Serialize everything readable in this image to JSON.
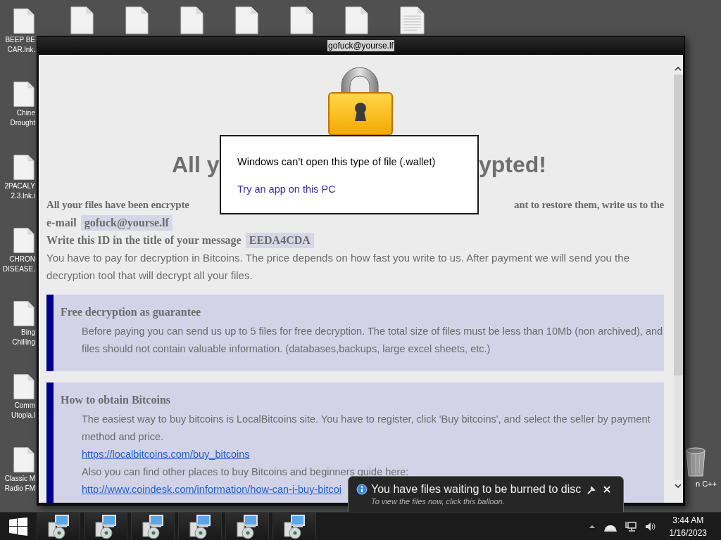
{
  "desktop": {
    "left_icons": [
      {
        "kind": "file",
        "label_lines": [
          "BEEP BE",
          "CAR.lnk."
        ]
      },
      {
        "kind": "file",
        "label_lines": [
          "Chine",
          "Drought"
        ]
      },
      {
        "kind": "file",
        "label_lines": [
          "2PACALY",
          "2.3.lnk.i"
        ]
      },
      {
        "kind": "file",
        "label_lines": [
          "CHRON",
          "DISEASE."
        ]
      },
      {
        "kind": "file",
        "label_lines": [
          "Bing",
          "Chilling"
        ]
      },
      {
        "kind": "file",
        "label_lines": [
          "Comm",
          "Utopia.l"
        ]
      },
      {
        "kind": "file",
        "label_lines": [
          "Classic M",
          "Radio FM"
        ]
      }
    ],
    "top_icons": [
      {
        "kind": "file"
      },
      {
        "kind": "file"
      },
      {
        "kind": "file"
      },
      {
        "kind": "file"
      },
      {
        "kind": "file"
      },
      {
        "kind": "file"
      },
      {
        "kind": "document"
      }
    ],
    "right_icons": [
      {
        "kind": "recycle_bin",
        "label_lines": [
          "n C++"
        ]
      }
    ]
  },
  "window": {
    "title": "gofuck@yourse.lf",
    "headline_visible": [
      "All y",
      "ypted!"
    ],
    "intro_visible": [
      "All your files have been encrypte",
      "ant to restore them, write us to the"
    ],
    "email_label": "e-mail",
    "email": "gofuck@yourse.lf",
    "id_label": "Write this ID in the title of your message",
    "id": "EEDA4CDA",
    "payment_text": "You have to pay for decryption in Bitcoins. The price depends on how fast you write to us. After payment we will send you the decryption tool that will decrypt all your files.",
    "sections": [
      {
        "title": "Free decryption as guarantee",
        "items": [
          {
            "kind": "text",
            "text": "Before paying you can send us up to 5 files for free decryption. The total size of files must be less than 10Mb (non archived), and files should not contain valuable information. (databases,backups, large excel sheets, etc.)"
          }
        ]
      },
      {
        "title": "How to obtain Bitcoins",
        "items": [
          {
            "kind": "text",
            "text": "The easiest way to buy bitcoins is LocalBitcoins site. You have to register, click 'Buy bitcoins', and select the seller by payment method and price."
          },
          {
            "kind": "link",
            "text": "https://localbitcoins.com/buy_bitcoins"
          },
          {
            "kind": "text",
            "text": "Also you can find other places to buy Bitcoins and beginners guide here:"
          },
          {
            "kind": "link",
            "text": "http://www.coindesk.com/information/how-can-i-buy-bitcoi"
          }
        ]
      }
    ]
  },
  "dialog": {
    "message": "Windows can’t open this type of file (.wallet)",
    "link": "Try an app on this PC"
  },
  "balloon": {
    "title": "You have files waiting to be burned to disc",
    "subtitle": "To view the files now, click this balloon."
  },
  "taskbar": {
    "buttons": [
      {
        "kind": "installer"
      },
      {
        "kind": "installer"
      },
      {
        "kind": "installer"
      },
      {
        "kind": "installer"
      },
      {
        "kind": "installer"
      },
      {
        "kind": "installer"
      }
    ],
    "clock": {
      "time": "3:44 AM",
      "date": "1/16/2023"
    }
  }
}
